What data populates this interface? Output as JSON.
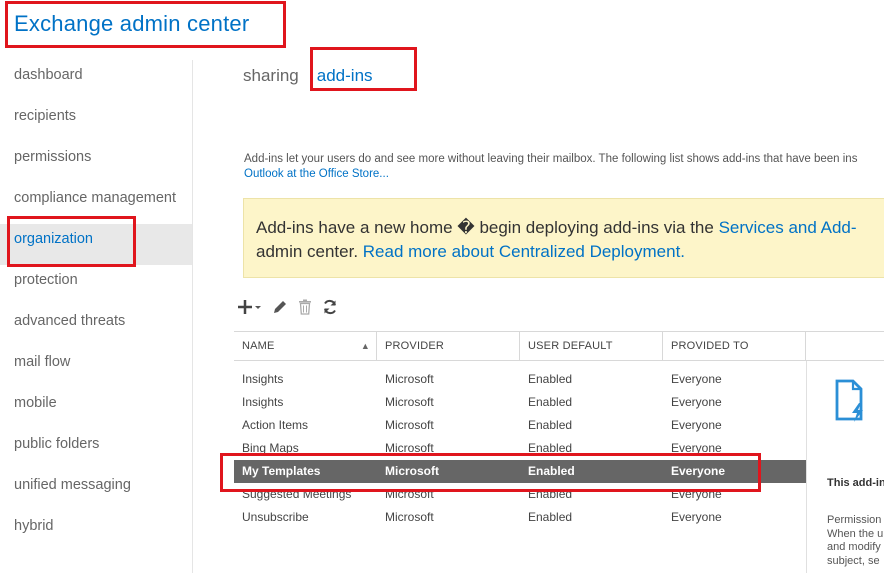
{
  "app": {
    "title": "Exchange admin center"
  },
  "sidebar": {
    "items": [
      {
        "label": "dashboard",
        "active": false
      },
      {
        "label": "recipients",
        "active": false
      },
      {
        "label": "permissions",
        "active": false
      },
      {
        "label": "compliance management",
        "active": false
      },
      {
        "label": "organization",
        "active": true
      },
      {
        "label": "protection",
        "active": false
      },
      {
        "label": "advanced threats",
        "active": false
      },
      {
        "label": "mail flow",
        "active": false
      },
      {
        "label": "mobile",
        "active": false
      },
      {
        "label": "public folders",
        "active": false
      },
      {
        "label": "unified messaging",
        "active": false
      },
      {
        "label": "hybrid",
        "active": false
      }
    ]
  },
  "tabs": [
    {
      "label": "sharing",
      "active": false
    },
    {
      "label": "add-ins",
      "active": true
    }
  ],
  "description": {
    "text": "Add-ins let your users do and see more without leaving their mailbox. The following list shows add-ins that have been ins",
    "link": "Outlook at the Office Store..."
  },
  "notice": {
    "line1": "Add-ins have a new home � begin deploying add-ins via the ",
    "link1": "Services and Add-",
    "line2": "admin center. ",
    "link2": "Read more about Centralized Deployment."
  },
  "toolbar": {
    "add_icon": "plus-icon",
    "edit_icon": "pencil-icon",
    "delete_icon": "trash-icon",
    "refresh_icon": "refresh-icon"
  },
  "table": {
    "columns": [
      "NAME",
      "PROVIDER",
      "USER DEFAULT",
      "PROVIDED TO"
    ],
    "sort_indicator": "▲",
    "rows": [
      {
        "name": " Insights",
        "provider": "Microsoft",
        "default": "Enabled",
        "to": "Everyone",
        "selected": false
      },
      {
        "name": " Insights",
        "provider": "Microsoft",
        "default": "Enabled",
        "to": "Everyone",
        "selected": false
      },
      {
        "name": "Action Items",
        "provider": "Microsoft",
        "default": "Enabled",
        "to": "Everyone",
        "selected": false
      },
      {
        "name": "Bing Maps",
        "provider": "Microsoft",
        "default": "Enabled",
        "to": "Everyone",
        "selected": false
      },
      {
        "name": "My Templates",
        "provider": "Microsoft",
        "default": "Enabled",
        "to": "Everyone",
        "selected": true
      },
      {
        "name": "Suggested Meetings",
        "provider": "Microsoft",
        "default": "Enabled",
        "to": "Everyone",
        "selected": false
      },
      {
        "name": "Unsubscribe",
        "provider": "Microsoft",
        "default": "Enabled",
        "to": "Everyone",
        "selected": false
      }
    ]
  },
  "detail": {
    "icon": "document-lightning-icon",
    "heading": "This add-in",
    "perm_line1": "Permission",
    "perm_line2": "When the u",
    "perm_line3": "and modify",
    "perm_line4": "subject, se"
  },
  "colors": {
    "accent": "#0072c6",
    "highlight": "#e0151d",
    "selected_row": "#666666",
    "notice_bg": "#fdf5c9"
  }
}
